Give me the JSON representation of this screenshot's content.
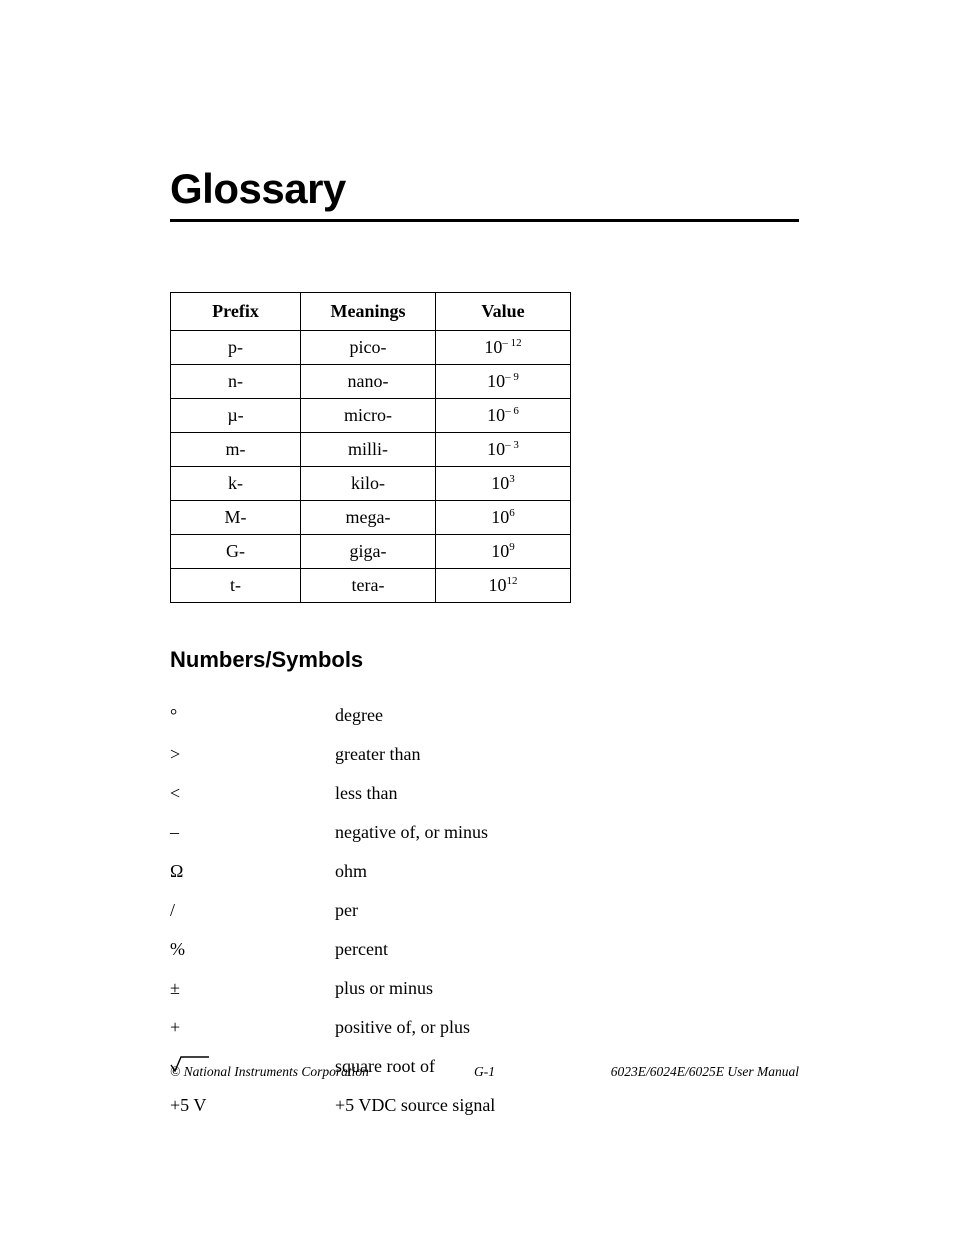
{
  "title": "Glossary",
  "table": {
    "headers": {
      "prefix": "Prefix",
      "meanings": "Meanings",
      "value": "Value"
    },
    "rows": [
      {
        "prefix": "p-",
        "meaning": "pico-",
        "base": "10",
        "exp": "– 12"
      },
      {
        "prefix": "n-",
        "meaning": "nano-",
        "base": "10",
        "exp": "– 9"
      },
      {
        "prefix": "µ-",
        "meaning": "micro-",
        "base": "10",
        "exp": "– 6"
      },
      {
        "prefix": "m-",
        "meaning": "milli-",
        "base": "10",
        "exp": "– 3"
      },
      {
        "prefix": "k-",
        "meaning": "kilo-",
        "base": "10",
        "exp": "3"
      },
      {
        "prefix": "M-",
        "meaning": "mega-",
        "base": "10",
        "exp": "6"
      },
      {
        "prefix": "G-",
        "meaning": "giga-",
        "base": "10",
        "exp": "9"
      },
      {
        "prefix": "t-",
        "meaning": "tera-",
        "base": "10",
        "exp": "12"
      }
    ]
  },
  "section_heading": "Numbers/Symbols",
  "definitions": [
    {
      "symbol": "°",
      "text": "degree"
    },
    {
      "symbol": ">",
      "text": "greater than"
    },
    {
      "symbol": "<",
      "text": "less than"
    },
    {
      "symbol": "–",
      "text": "negative of, or minus"
    },
    {
      "symbol": "Ω",
      "text": "ohm"
    },
    {
      "symbol": "/",
      "text": "per"
    },
    {
      "symbol": "%",
      "text": "percent"
    },
    {
      "symbol": "±",
      "text": "plus or minus"
    },
    {
      "symbol": "+",
      "text": "positive of, or plus"
    },
    {
      "symbol": "__SQRT__",
      "text": "square root of"
    },
    {
      "symbol": "+5 V",
      "text": "+5 VDC source signal"
    }
  ],
  "footer": {
    "left": "© National Instruments Corporation",
    "center": "G-1",
    "right": "6023E/6024E/6025E User Manual"
  }
}
